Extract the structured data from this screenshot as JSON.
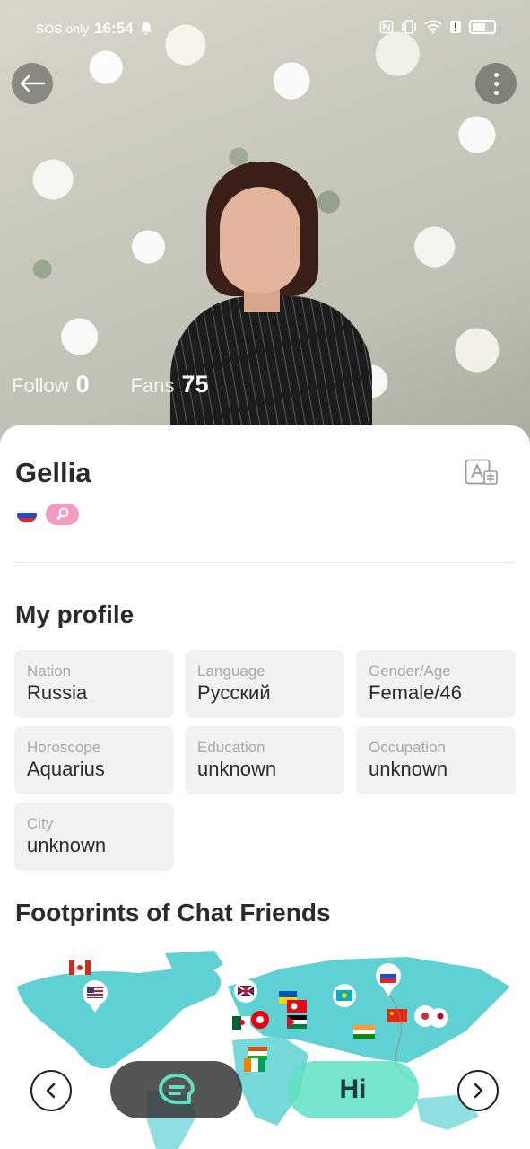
{
  "status_bar": {
    "carrier": "SOS only",
    "time": "16:54",
    "icons": [
      "bell-icon",
      "nfc-icon",
      "vibrate-icon",
      "wifi-icon",
      "alert-icon",
      "battery-icon"
    ]
  },
  "header": {
    "back_icon": "arrow-left-icon",
    "more_icon": "more-vertical-icon"
  },
  "stats": {
    "follow_label": "Follow",
    "follow_value": "0",
    "fans_label": "Fans",
    "fans_value": "75"
  },
  "user": {
    "name": "Gellia",
    "flag": "russia-flag-icon",
    "gender_icon": "female-icon",
    "gender_color": "#f39bc0"
  },
  "profile": {
    "title": "My profile",
    "fields": [
      {
        "label": "Nation",
        "value": "Russia"
      },
      {
        "label": "Language",
        "value": "Русский"
      },
      {
        "label": "Gender/Age",
        "value": "Female/46"
      },
      {
        "label": "Horoscope",
        "value": "Aquarius"
      },
      {
        "label": "Education",
        "value": "unknown"
      },
      {
        "label": "Occupation",
        "value": "unknown"
      },
      {
        "label": "City",
        "value": "unknown"
      }
    ]
  },
  "footprints": {
    "title": "Footprints of Chat Friends",
    "map_color": "#5fd1d4"
  },
  "actions": {
    "hi_label": "Hi",
    "chat_icon": "chat-bubble-icon",
    "hi_color": "#5fe0c4",
    "chat_color": "#373737"
  }
}
